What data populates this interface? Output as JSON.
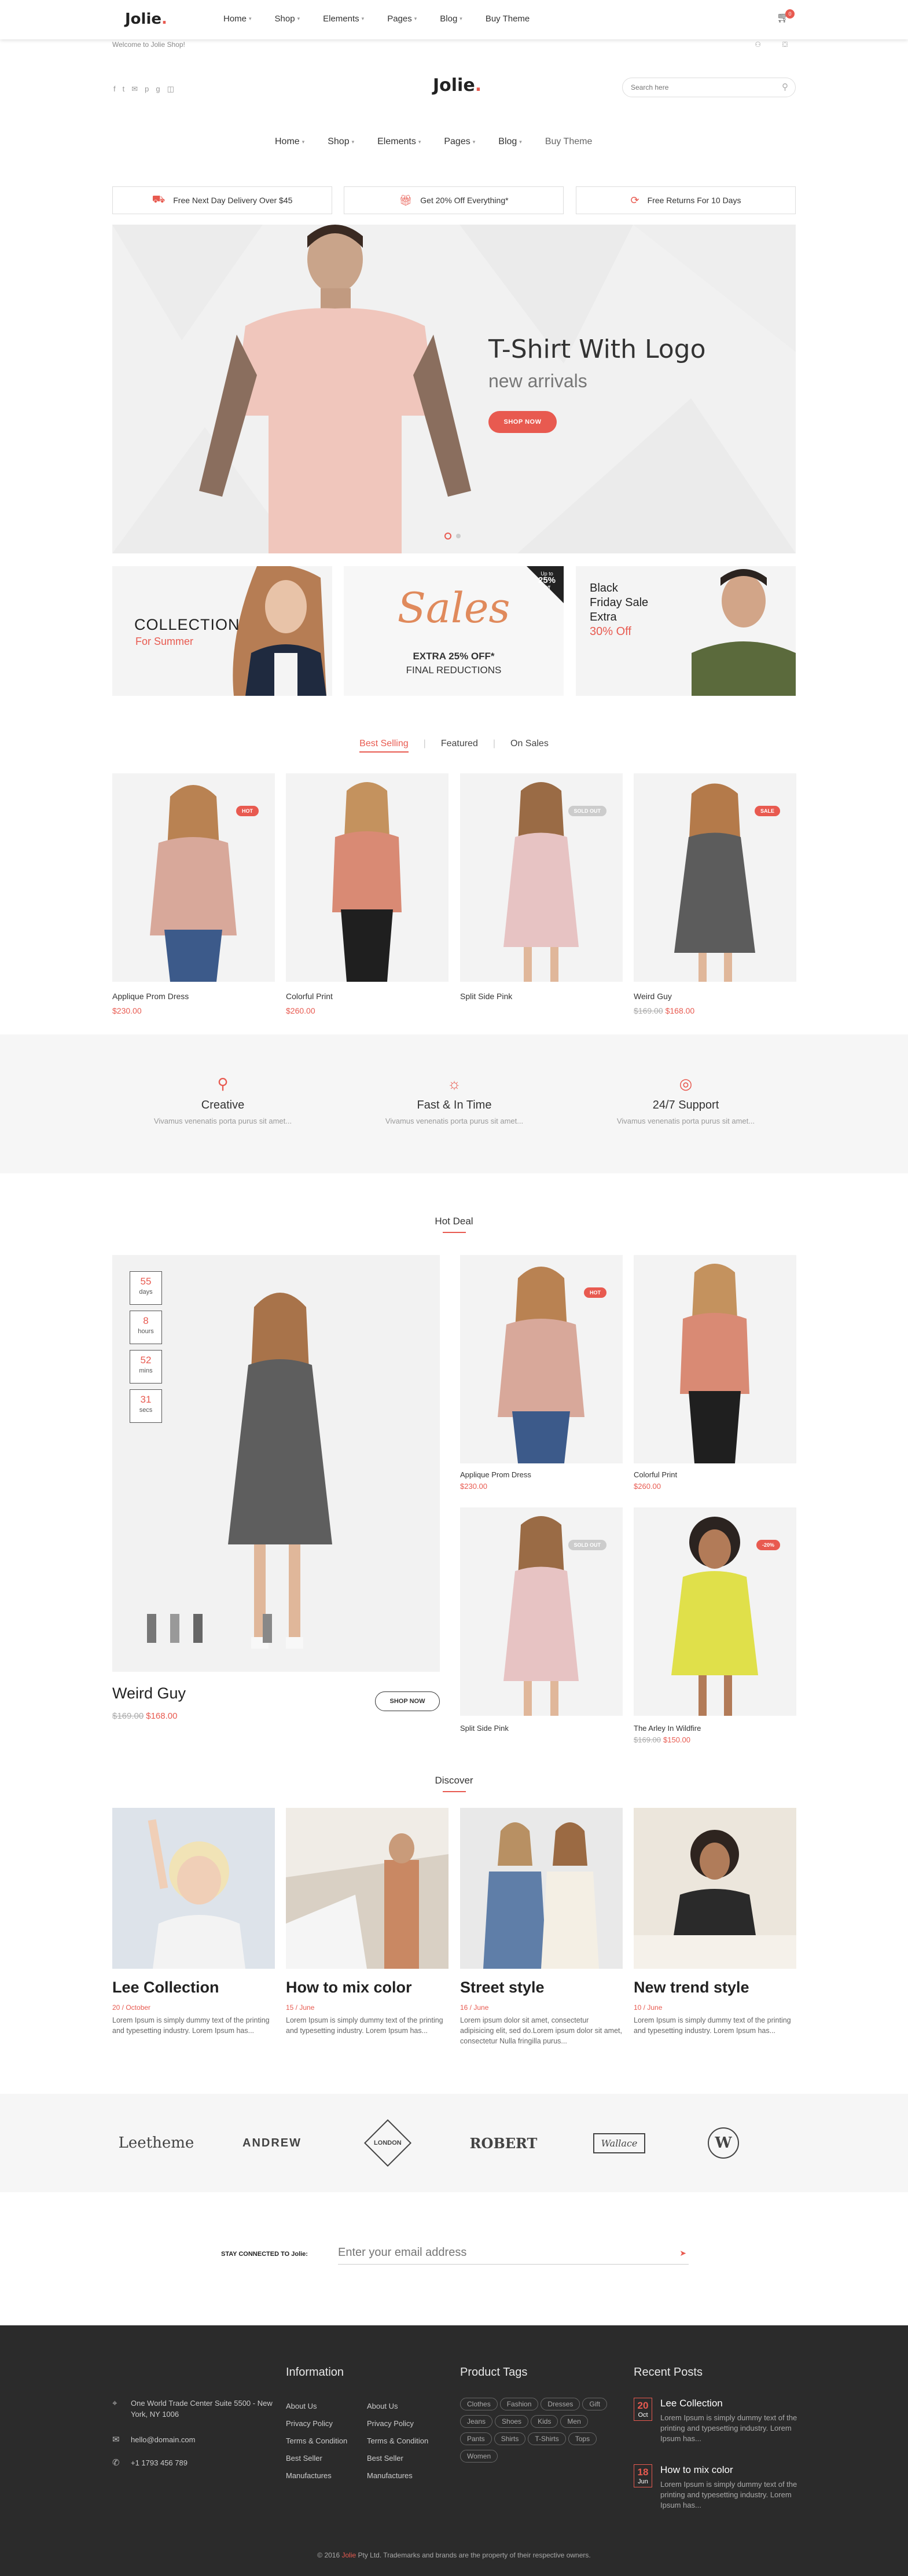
{
  "brand": {
    "name": "Jolie",
    "dot": ".",
    "accent": "#e85a50"
  },
  "sticky_nav": {
    "items": [
      "Home",
      "Shop",
      "Elements",
      "Pages",
      "Blog",
      "Buy Theme"
    ],
    "cart_count": "0"
  },
  "topbar": {
    "welcome": "Welcome to Jolie Shop!"
  },
  "search": {
    "placeholder": "Search here"
  },
  "main_nav": {
    "items": [
      "Home",
      "Shop",
      "Elements",
      "Pages",
      "Blog",
      "Buy Theme"
    ]
  },
  "features": [
    {
      "icon": "truck-icon",
      "text": "Free Next Day Delivery Over $45"
    },
    {
      "icon": "gift-icon",
      "text": "Get 20% Off Everything*"
    },
    {
      "icon": "refresh-icon",
      "text": "Free Returns For 10 Days"
    }
  ],
  "hero": {
    "title": "T-Shirt With Logo",
    "subtitle": "new arrivals",
    "button": "SHOP NOW"
  },
  "banners": {
    "b1": {
      "title": "COLLECTION",
      "subtitle": "For Summer"
    },
    "b2": {
      "script": "Sales",
      "line1": "EXTRA 25% OFF*",
      "line2": "FINAL REDUCTIONS",
      "corner_top": "Up to",
      "corner_value": "25%",
      "corner_bottom": "Off"
    },
    "b3": {
      "line1": "Black",
      "line2": "Friday Sale",
      "line3": "Extra",
      "line4": "30% Off"
    }
  },
  "product_tabs": [
    "Best Selling",
    "Featured",
    "On Sales"
  ],
  "products": [
    {
      "name": "Applique Prom Dress",
      "price": "$230.00",
      "old": "",
      "badge": "HOT"
    },
    {
      "name": "Colorful Print",
      "price": "$260.00",
      "old": "",
      "badge": ""
    },
    {
      "name": "Split Side Pink",
      "price": "",
      "old": "",
      "badge": "SOLD OUT"
    },
    {
      "name": "Weird Guy",
      "price": "$168.00",
      "old": "$169.00",
      "badge": "SALE"
    }
  ],
  "services": [
    {
      "icon": "lamp-icon",
      "title": "Creative",
      "desc": "Vivamus venenatis porta purus sit amet..."
    },
    {
      "icon": "bulb-icon",
      "title": "Fast & In Time",
      "desc": "Vivamus venenatis porta purus sit amet..."
    },
    {
      "icon": "support-icon",
      "title": "24/7 Support",
      "desc": "Vivamus venenatis porta purus sit amet..."
    }
  ],
  "hot_deal": {
    "title": "Hot Deal",
    "countdown": [
      {
        "n": "55",
        "u": "days"
      },
      {
        "n": "8",
        "u": "hours"
      },
      {
        "n": "52",
        "u": "mins"
      },
      {
        "n": "31",
        "u": "secs"
      }
    ],
    "product": {
      "name": "Weird Guy",
      "old": "$169.00",
      "price": "$168.00",
      "button": "SHOP NOW"
    },
    "grid": [
      {
        "name": "Applique Prom Dress",
        "price": "$230.00",
        "old": "",
        "badge": "HOT"
      },
      {
        "name": "Colorful Print",
        "price": "$260.00",
        "old": "",
        "badge": ""
      },
      {
        "name": "Split Side Pink",
        "price": "",
        "old": "",
        "badge": "SOLD OUT"
      },
      {
        "name": "The Arley In Wildfire",
        "price": "$150.00",
        "old": "$169.00",
        "badge": "-20%"
      }
    ]
  },
  "discover": {
    "title": "Discover",
    "posts": [
      {
        "title": "Lee Collection",
        "date": "20 / October",
        "excerpt": "Lorem Ipsum is simply dummy text of the printing and typesetting industry. Lorem Ipsum has..."
      },
      {
        "title": "How to mix color",
        "date": "15 / June",
        "excerpt": "Lorem Ipsum is simply dummy text of the printing and typesetting industry. Lorem Ipsum has..."
      },
      {
        "title": "Street style",
        "date": "16 / June",
        "excerpt": "Lorem ipsum dolor sit amet, consectetur adipisicing elit, sed do.Lorem ipsum dolor sit amet, consectetur Nulla fringilla purus..."
      },
      {
        "title": "New trend style",
        "date": "10 / June",
        "excerpt": "Lorem Ipsum is simply dummy text of the printing and typesetting industry. Lorem Ipsum has..."
      }
    ]
  },
  "brands": [
    "Leetheme",
    "ANDREW",
    "LONDON",
    "ROBERT",
    "Wallace",
    "W"
  ],
  "newsletter": {
    "label": "STAY CONNECTED TO Jolie:",
    "placeholder": "Enter your email address",
    "icon": "send-icon"
  },
  "footer": {
    "address": "One World Trade Center Suite 5500 - New York, NY 1006",
    "email": "hello@domain.com",
    "phone": "+1 1793 456 789",
    "info_title": "Information",
    "info_col1": [
      "About Us",
      "Privacy Policy",
      "Terms & Condition",
      "Best Seller",
      "Manufactures"
    ],
    "info_col2": [
      "About Us",
      "Privacy Policy",
      "Terms & Condition",
      "Best Seller",
      "Manufactures"
    ],
    "tags_title": "Product Tags",
    "tags": [
      "Clothes",
      "Fashion",
      "Dresses",
      "Gift",
      "Jeans",
      "Shoes",
      "Kids",
      "Men",
      "Pants",
      "Shirts",
      "T-Shirts",
      "Tops",
      "Women"
    ],
    "recent_title": "Recent Posts",
    "recent": [
      {
        "day": "20",
        "month": "Oct",
        "title": "Lee Collection",
        "excerpt": "Lorem Ipsum is simply dummy text of the printing and typesetting industry. Lorem Ipsum has..."
      },
      {
        "day": "18",
        "month": "Jun",
        "title": "How to mix color",
        "excerpt": "Lorem Ipsum is simply dummy text of the printing and typesetting industry. Lorem Ipsum has..."
      }
    ],
    "copyright_pre": "© 2016 ",
    "copyright_brand": "Jolie",
    "copyright_post": " Pty Ltd. Trademarks and brands are the property of their respective owners."
  }
}
